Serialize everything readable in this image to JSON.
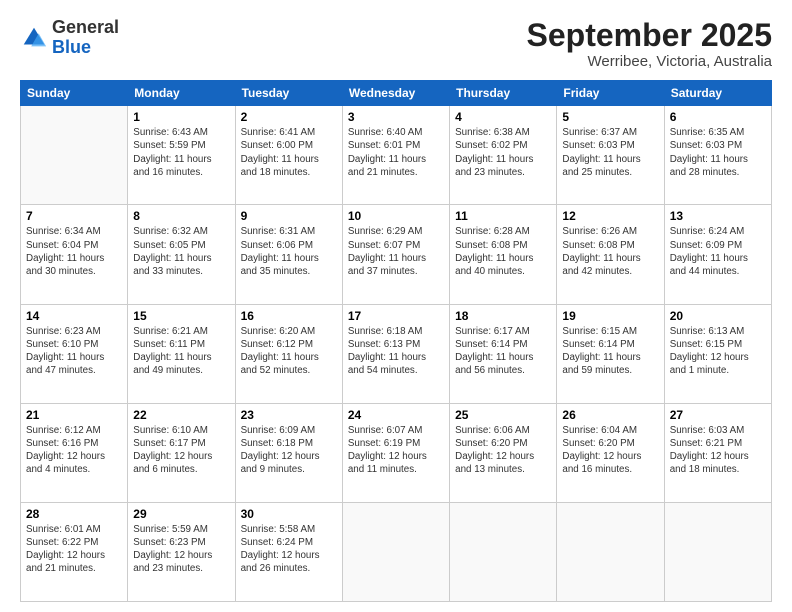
{
  "logo": {
    "general": "General",
    "blue": "Blue"
  },
  "header": {
    "month": "September 2025",
    "location": "Werribee, Victoria, Australia"
  },
  "weekdays": [
    "Sunday",
    "Monday",
    "Tuesday",
    "Wednesday",
    "Thursday",
    "Friday",
    "Saturday"
  ],
  "weeks": [
    [
      {
        "day": "",
        "info": ""
      },
      {
        "day": "1",
        "info": "Sunrise: 6:43 AM\nSunset: 5:59 PM\nDaylight: 11 hours\nand 16 minutes."
      },
      {
        "day": "2",
        "info": "Sunrise: 6:41 AM\nSunset: 6:00 PM\nDaylight: 11 hours\nand 18 minutes."
      },
      {
        "day": "3",
        "info": "Sunrise: 6:40 AM\nSunset: 6:01 PM\nDaylight: 11 hours\nand 21 minutes."
      },
      {
        "day": "4",
        "info": "Sunrise: 6:38 AM\nSunset: 6:02 PM\nDaylight: 11 hours\nand 23 minutes."
      },
      {
        "day": "5",
        "info": "Sunrise: 6:37 AM\nSunset: 6:03 PM\nDaylight: 11 hours\nand 25 minutes."
      },
      {
        "day": "6",
        "info": "Sunrise: 6:35 AM\nSunset: 6:03 PM\nDaylight: 11 hours\nand 28 minutes."
      }
    ],
    [
      {
        "day": "7",
        "info": "Sunrise: 6:34 AM\nSunset: 6:04 PM\nDaylight: 11 hours\nand 30 minutes."
      },
      {
        "day": "8",
        "info": "Sunrise: 6:32 AM\nSunset: 6:05 PM\nDaylight: 11 hours\nand 33 minutes."
      },
      {
        "day": "9",
        "info": "Sunrise: 6:31 AM\nSunset: 6:06 PM\nDaylight: 11 hours\nand 35 minutes."
      },
      {
        "day": "10",
        "info": "Sunrise: 6:29 AM\nSunset: 6:07 PM\nDaylight: 11 hours\nand 37 minutes."
      },
      {
        "day": "11",
        "info": "Sunrise: 6:28 AM\nSunset: 6:08 PM\nDaylight: 11 hours\nand 40 minutes."
      },
      {
        "day": "12",
        "info": "Sunrise: 6:26 AM\nSunset: 6:08 PM\nDaylight: 11 hours\nand 42 minutes."
      },
      {
        "day": "13",
        "info": "Sunrise: 6:24 AM\nSunset: 6:09 PM\nDaylight: 11 hours\nand 44 minutes."
      }
    ],
    [
      {
        "day": "14",
        "info": "Sunrise: 6:23 AM\nSunset: 6:10 PM\nDaylight: 11 hours\nand 47 minutes."
      },
      {
        "day": "15",
        "info": "Sunrise: 6:21 AM\nSunset: 6:11 PM\nDaylight: 11 hours\nand 49 minutes."
      },
      {
        "day": "16",
        "info": "Sunrise: 6:20 AM\nSunset: 6:12 PM\nDaylight: 11 hours\nand 52 minutes."
      },
      {
        "day": "17",
        "info": "Sunrise: 6:18 AM\nSunset: 6:13 PM\nDaylight: 11 hours\nand 54 minutes."
      },
      {
        "day": "18",
        "info": "Sunrise: 6:17 AM\nSunset: 6:14 PM\nDaylight: 11 hours\nand 56 minutes."
      },
      {
        "day": "19",
        "info": "Sunrise: 6:15 AM\nSunset: 6:14 PM\nDaylight: 11 hours\nand 59 minutes."
      },
      {
        "day": "20",
        "info": "Sunrise: 6:13 AM\nSunset: 6:15 PM\nDaylight: 12 hours\nand 1 minute."
      }
    ],
    [
      {
        "day": "21",
        "info": "Sunrise: 6:12 AM\nSunset: 6:16 PM\nDaylight: 12 hours\nand 4 minutes."
      },
      {
        "day": "22",
        "info": "Sunrise: 6:10 AM\nSunset: 6:17 PM\nDaylight: 12 hours\nand 6 minutes."
      },
      {
        "day": "23",
        "info": "Sunrise: 6:09 AM\nSunset: 6:18 PM\nDaylight: 12 hours\nand 9 minutes."
      },
      {
        "day": "24",
        "info": "Sunrise: 6:07 AM\nSunset: 6:19 PM\nDaylight: 12 hours\nand 11 minutes."
      },
      {
        "day": "25",
        "info": "Sunrise: 6:06 AM\nSunset: 6:20 PM\nDaylight: 12 hours\nand 13 minutes."
      },
      {
        "day": "26",
        "info": "Sunrise: 6:04 AM\nSunset: 6:20 PM\nDaylight: 12 hours\nand 16 minutes."
      },
      {
        "day": "27",
        "info": "Sunrise: 6:03 AM\nSunset: 6:21 PM\nDaylight: 12 hours\nand 18 minutes."
      }
    ],
    [
      {
        "day": "28",
        "info": "Sunrise: 6:01 AM\nSunset: 6:22 PM\nDaylight: 12 hours\nand 21 minutes."
      },
      {
        "day": "29",
        "info": "Sunrise: 5:59 AM\nSunset: 6:23 PM\nDaylight: 12 hours\nand 23 minutes."
      },
      {
        "day": "30",
        "info": "Sunrise: 5:58 AM\nSunset: 6:24 PM\nDaylight: 12 hours\nand 26 minutes."
      },
      {
        "day": "",
        "info": ""
      },
      {
        "day": "",
        "info": ""
      },
      {
        "day": "",
        "info": ""
      },
      {
        "day": "",
        "info": ""
      }
    ]
  ]
}
